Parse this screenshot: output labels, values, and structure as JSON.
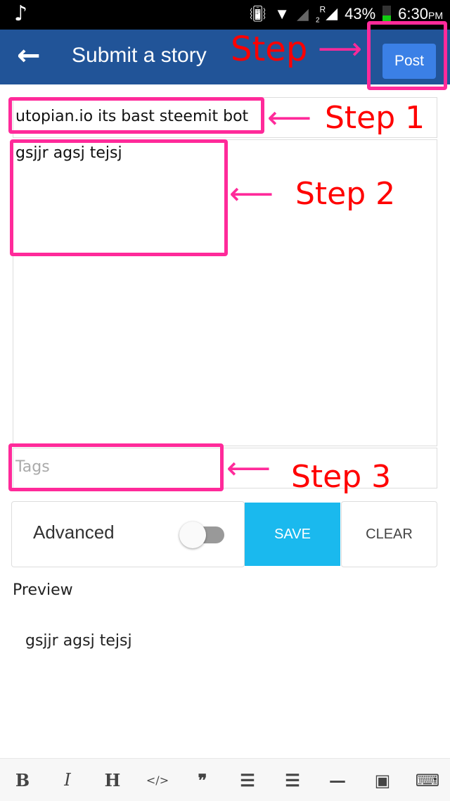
{
  "status": {
    "music_icon": "music-note",
    "battery": "43%",
    "time": "6:30",
    "ampm": "PM",
    "sim": "R",
    "sim_slot": "2"
  },
  "appbar": {
    "title": "Submit a story",
    "post_label": "Post"
  },
  "form": {
    "title_value": "utopian.io its bast steemit bot",
    "body_value": "gsjjr agsj tejsj",
    "tags_placeholder": "Tags",
    "advanced_label": "Advanced",
    "advanced_on": false,
    "save_label": "SAVE",
    "clear_label": "CLEAR"
  },
  "preview": {
    "heading": "Preview",
    "text": "gsjjr agsj tejsj"
  },
  "toolbar": [
    {
      "icon": "bold-icon",
      "glyph": "B"
    },
    {
      "icon": "italic-icon",
      "glyph": "I"
    },
    {
      "icon": "heading-icon",
      "glyph": "H"
    },
    {
      "icon": "code-icon",
      "glyph": "</>"
    },
    {
      "icon": "quote-icon",
      "glyph": "❞"
    },
    {
      "icon": "ordered-list-icon",
      "glyph": "☰"
    },
    {
      "icon": "unordered-list-icon",
      "glyph": "☰"
    },
    {
      "icon": "horizontal-rule-icon",
      "glyph": "—"
    },
    {
      "icon": "image-icon",
      "glyph": "▣"
    },
    {
      "icon": "keyboard-icon",
      "glyph": "⌨"
    }
  ],
  "annotations": {
    "step0": "Step",
    "step1": "Step 1",
    "step2": "Step 2",
    "step3": "Step 3",
    "color": "#ff2a9a"
  }
}
